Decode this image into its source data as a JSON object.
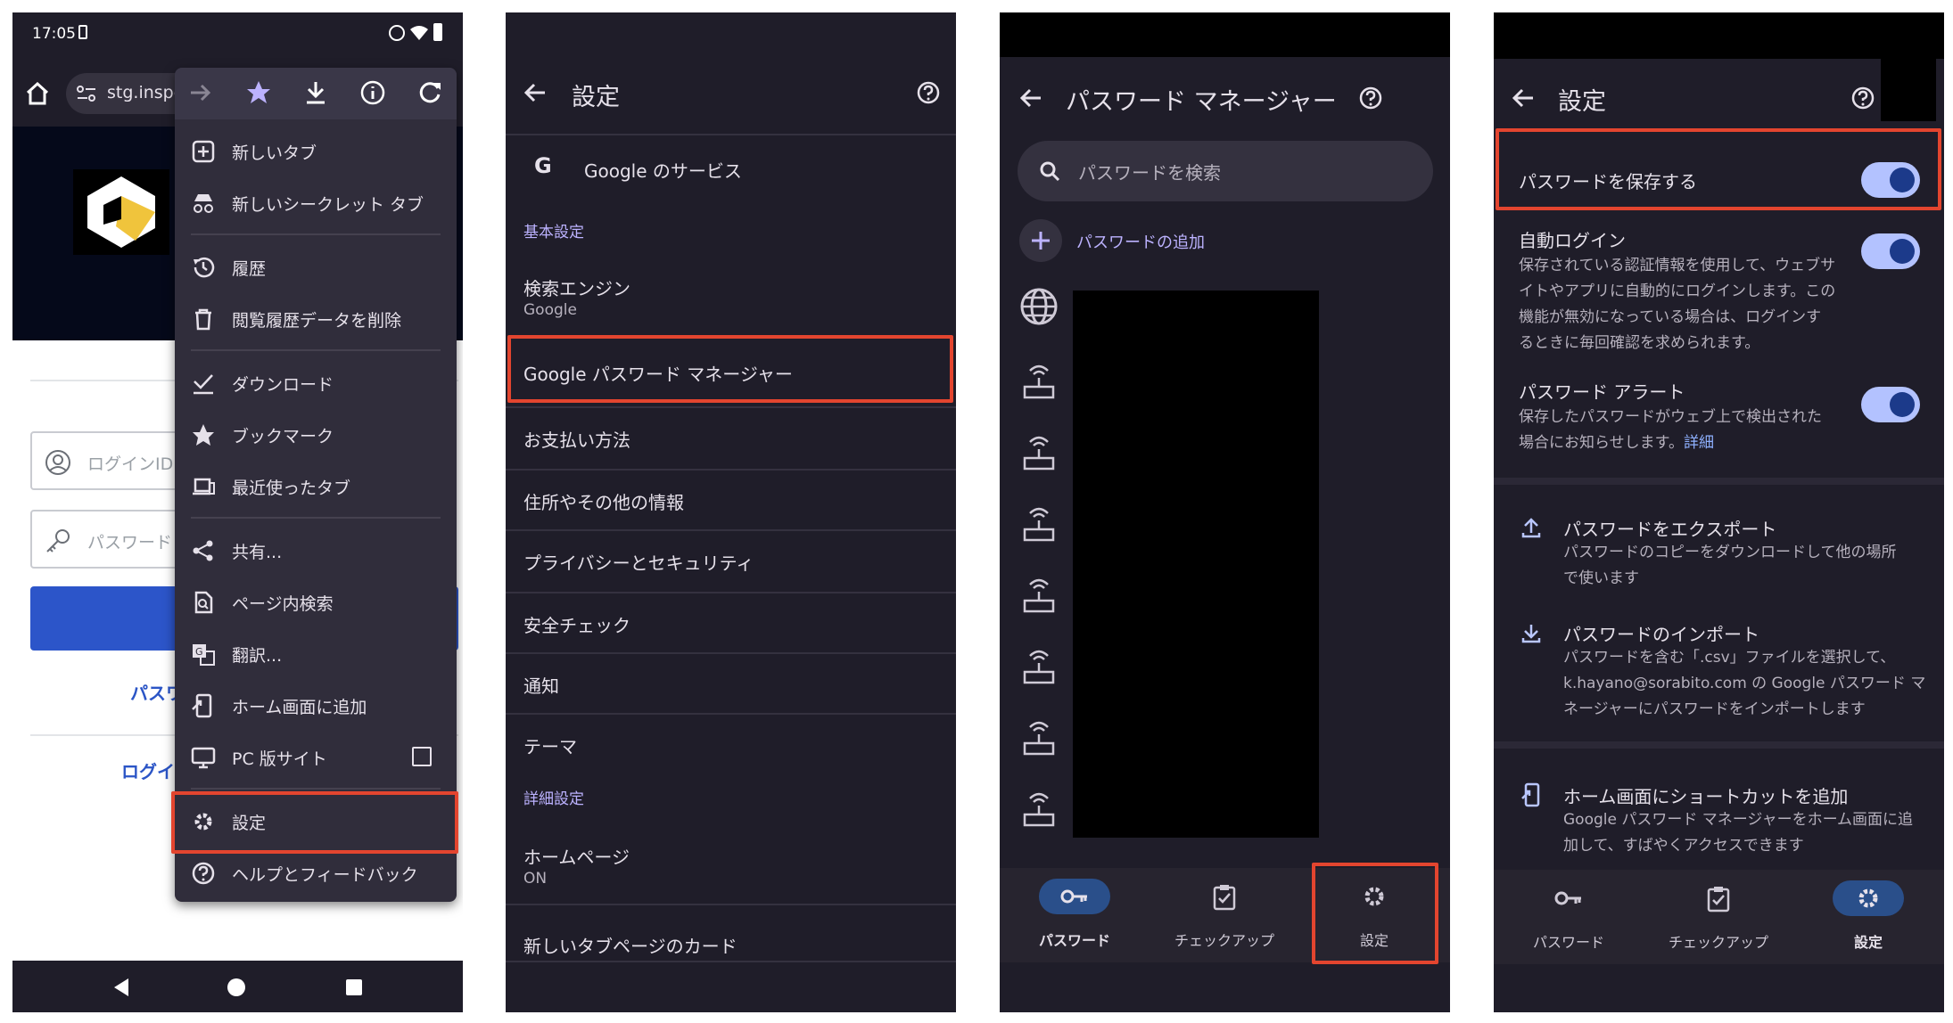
{
  "panel1": {
    "status_time": "17:05",
    "url_text": "stg.inspe",
    "field_login_placeholder": "ログインID",
    "field_password_placeholder": "パスワード",
    "link1": "パスワ",
    "link2": "ログイ",
    "menu": {
      "items": [
        {
          "label": "新しいタブ",
          "icon": "new-tab-icon"
        },
        {
          "label": "新しいシークレット タブ",
          "icon": "incognito-icon"
        },
        {
          "label": "履歴",
          "icon": "history-icon"
        },
        {
          "label": "閲覧履歴データを削除",
          "icon": "trash-icon"
        },
        {
          "label": "ダウンロード",
          "icon": "download-check-icon"
        },
        {
          "label": "ブックマーク",
          "icon": "star-icon"
        },
        {
          "label": "最近使ったタブ",
          "icon": "devices-icon"
        },
        {
          "label": "共有...",
          "icon": "share-icon"
        },
        {
          "label": "ページ内検索",
          "icon": "find-in-page-icon"
        },
        {
          "label": "翻訳...",
          "icon": "translate-icon"
        },
        {
          "label": "ホーム画面に追加",
          "icon": "add-to-home-icon"
        },
        {
          "label": "PC 版サイト",
          "icon": "desktop-icon"
        },
        {
          "label": "設定",
          "icon": "gear-icon"
        },
        {
          "label": "ヘルプとフィードバック",
          "icon": "help-icon"
        }
      ]
    }
  },
  "panel2": {
    "title": "設定",
    "google_services": "Google のサービス",
    "section_basic": "基本設定",
    "search_engine": "検索エンジン",
    "search_engine_value": "Google",
    "password_manager": "Google パスワード マネージャー",
    "payment": "お支払い方法",
    "addresses": "住所やその他の情報",
    "privacy": "プライバシーとセキュリティ",
    "safety_check": "安全チェック",
    "notifications": "通知",
    "theme": "テーマ",
    "section_advanced": "詳細設定",
    "homepage": "ホームページ",
    "homepage_value": "ON",
    "ntp_cards": "新しいタブページのカード"
  },
  "panel3": {
    "title": "パスワード マネージャー",
    "search_placeholder": "パスワードを検索",
    "add_password": "パスワードの追加",
    "nav": {
      "passwords": "パスワード",
      "checkup": "チェックアップ",
      "settings": "設定"
    }
  },
  "panel4": {
    "title": "設定",
    "save_passwords": "パスワードを保存する",
    "auto_signin": "自動ログイン",
    "auto_signin_desc": [
      "保存されている認証情報を使用して、ウェブサ",
      "イトやアプリに自動的にログインします。この",
      "機能が無効になっている場合は、ログインす",
      "るときに毎回確認を求められます。"
    ],
    "password_alerts": "パスワード アラート",
    "password_alerts_desc": [
      "保存したパスワードがウェブ上で検出された",
      "場合にお知らせします。"
    ],
    "password_alerts_link": "詳細",
    "export_title": "パスワードをエクスポート",
    "export_desc": [
      "パスワードのコピーをダウンロードして他の場所",
      "で使います"
    ],
    "import_title": "パスワードのインポート",
    "import_desc": [
      "パスワードを含む「.csv」ファイルを選択して、",
      "k.hayano@sorabito.com の Google パスワード マ",
      "ネージャーにパスワードをインポートします"
    ],
    "shortcut_title": "ホーム画面にショートカットを追加",
    "shortcut_desc": [
      "Google パスワード マネージャーをホーム画面に追",
      "加して、すばやくアクセスできます"
    ],
    "nav": {
      "passwords": "パスワード",
      "checkup": "チェックアップ",
      "settings": "設定"
    }
  }
}
